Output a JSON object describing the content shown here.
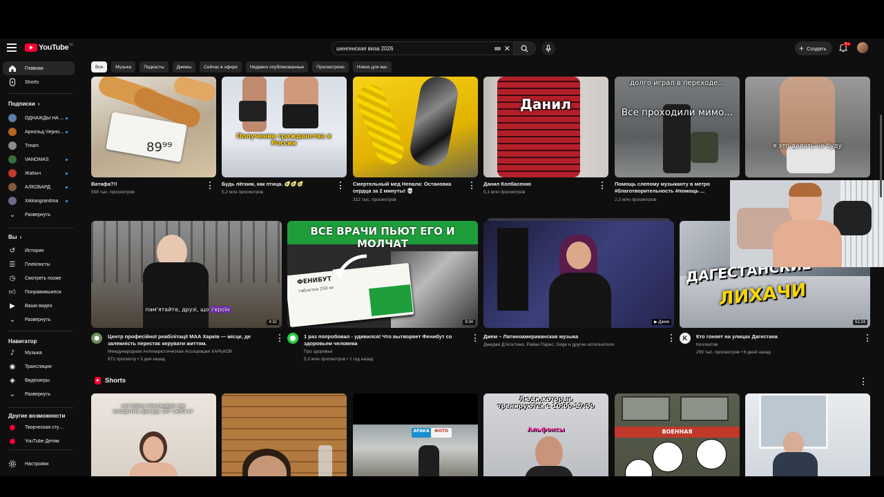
{
  "logo": {
    "text": "YouTube",
    "region": "RU"
  },
  "search": {
    "value": "шенгенская виза 2026"
  },
  "header": {
    "create_label": "Создать",
    "notif_badge": "9+"
  },
  "sidebar": {
    "main": [
      {
        "label": "Главная",
        "icon": "home-icon",
        "active": true
      },
      {
        "label": "Shorts",
        "icon": "shorts-icon"
      }
    ],
    "subs_title": "Подписки",
    "subs": [
      {
        "label": "ОДНАЖДЫ НА ...",
        "color": "#5b7fa8",
        "dot": true
      },
      {
        "label": "Арнольд Черно...",
        "color": "#b5651d",
        "dot": true
      },
      {
        "label": "Tream",
        "color": "#8a8a8a",
        "dot": false
      },
      {
        "label": "VANOMAS",
        "color": "#3a6e3a",
        "dot": true
      },
      {
        "label": "Жабыч",
        "color": "#c0392b",
        "dot": true
      },
      {
        "label": "АЛКОБАРД",
        "color": "#7d5a3c",
        "dot": true
      },
      {
        "label": "Xikkasgrandma",
        "color": "#6c6c8a",
        "dot": true
      },
      {
        "label": "Развернуть",
        "expand": true
      }
    ],
    "you_title": "Вы",
    "you": [
      {
        "label": "История",
        "icon": "history-icon"
      },
      {
        "label": "Плейлисты",
        "icon": "playlists-icon"
      },
      {
        "label": "Смотреть позже",
        "icon": "watch-later-icon"
      },
      {
        "label": "Понравившиеся",
        "icon": "like-icon"
      },
      {
        "label": "Ваши видео",
        "icon": "your-videos-icon"
      },
      {
        "label": "Развернуть",
        "icon": "chevron-down-icon"
      }
    ],
    "nav_title": "Навигатор",
    "nav": [
      {
        "label": "Музыка",
        "icon": "music-icon"
      },
      {
        "label": "Трансляции",
        "icon": "live-icon"
      },
      {
        "label": "Видеоигры",
        "icon": "gaming-icon"
      },
      {
        "label": "Развернуть",
        "icon": "chevron-down-icon"
      }
    ],
    "more_title": "Другие возможности",
    "more": [
      {
        "label": "Творческая студи...",
        "icon": "studio-icon"
      },
      {
        "label": "YouTube Детям",
        "icon": "kids-icon"
      }
    ],
    "settings_label": "Настройки"
  },
  "chips": [
    "Все",
    "Музыка",
    "Подкасты",
    "Джемы",
    "Сейчас в эфире",
    "Недавно опубликованные",
    "Просмотрено",
    "Новое для вас"
  ],
  "row1": [
    {
      "title": "Ватафа?!!",
      "meta": "558 тыс. просмотров",
      "overlay": "",
      "price": "89⁹⁹"
    },
    {
      "title": "Будь лёгким, как птица. 🥑🥑🥑",
      "meta": "5,2 млн просмотров",
      "overlay": "Получение гражданства в России"
    },
    {
      "title": "Смертельный мед Непала: Остановка сердца за 2 минуты! 💀",
      "meta": "312 тыс. просмотров",
      "overlay": ""
    },
    {
      "title": "Данил Колбасенко",
      "meta": "5,1 млн просмотров",
      "overlay": "Данил"
    },
    {
      "title": "Помощь слепому музыканту в метро #благотворительность #помощь ...",
      "meta": "2,3 млн просмотров",
      "overlay": "Все проходили мимо...",
      "overlay_top": "долго играл в переходе..."
    },
    {
      "title": "",
      "meta": "",
      "overlay": "я это делать не буду"
    }
  ],
  "row2": [
    {
      "title": "Центр професійної реабілітації МАА Харків — місце, де залежність перестає керувати життям.",
      "channel": "Международная Антинаркотическая Ассоциация ХАРЬКОВ",
      "meta": "871 просмотр • 3 дня назад",
      "duration": "4:32",
      "subtitle": "пам'ятайте, друзі, що ",
      "subtitle_hl": "героїн",
      "av": "#6b8e5a"
    },
    {
      "title": "1 раз попробовал - удивился! Что вытворяет Фенибут со здоровьем человека",
      "channel": "Про здоровье",
      "meta": "5,2 млн просмотров • 1 год назад",
      "duration": "9:34",
      "banner": "ВСЕ ВРАЧИ ПЬЮТ ЕГО И МОЛЧАТ",
      "box": "ФЕНИБУТ",
      "box_sub": "таблетки 250 мг",
      "av": "#2ecc40"
    },
    {
      "title": "Джем – Латиноамериканская музыка",
      "channel": "Джиджи Д'Агостино, Райан Парис, Gege и другие исполнители",
      "meta": "",
      "duration": "Джем"
    },
    {
      "title": "Кто гоняет на улицах Дагестана",
      "channel": "Коллектив",
      "meta": "259 тыс. просмотров • 6 дней назад",
      "duration": "51:24",
      "overlay": "ДАГЕСТАНСКИЕ",
      "overlay2": "ЛИХАЧИ",
      "av": "#ddd"
    }
  ],
  "shorts": {
    "title": "Shorts",
    "items": [
      {
        "overlay": "наглядно показываю как испортить фигуру 167 см/64 кг"
      },
      {
        "overlay": ""
      },
      {
        "overlay": "",
        "sign1": "АРАКА",
        "sign2": "ФОТО"
      },
      {
        "overlay": "Люди,которые тренируются с 10:00-17:00",
        "overlay2": "Альфонсы"
      },
      {
        "overlay": "ВОЕННАЯ"
      },
      {
        "overlay": ""
      }
    ]
  }
}
